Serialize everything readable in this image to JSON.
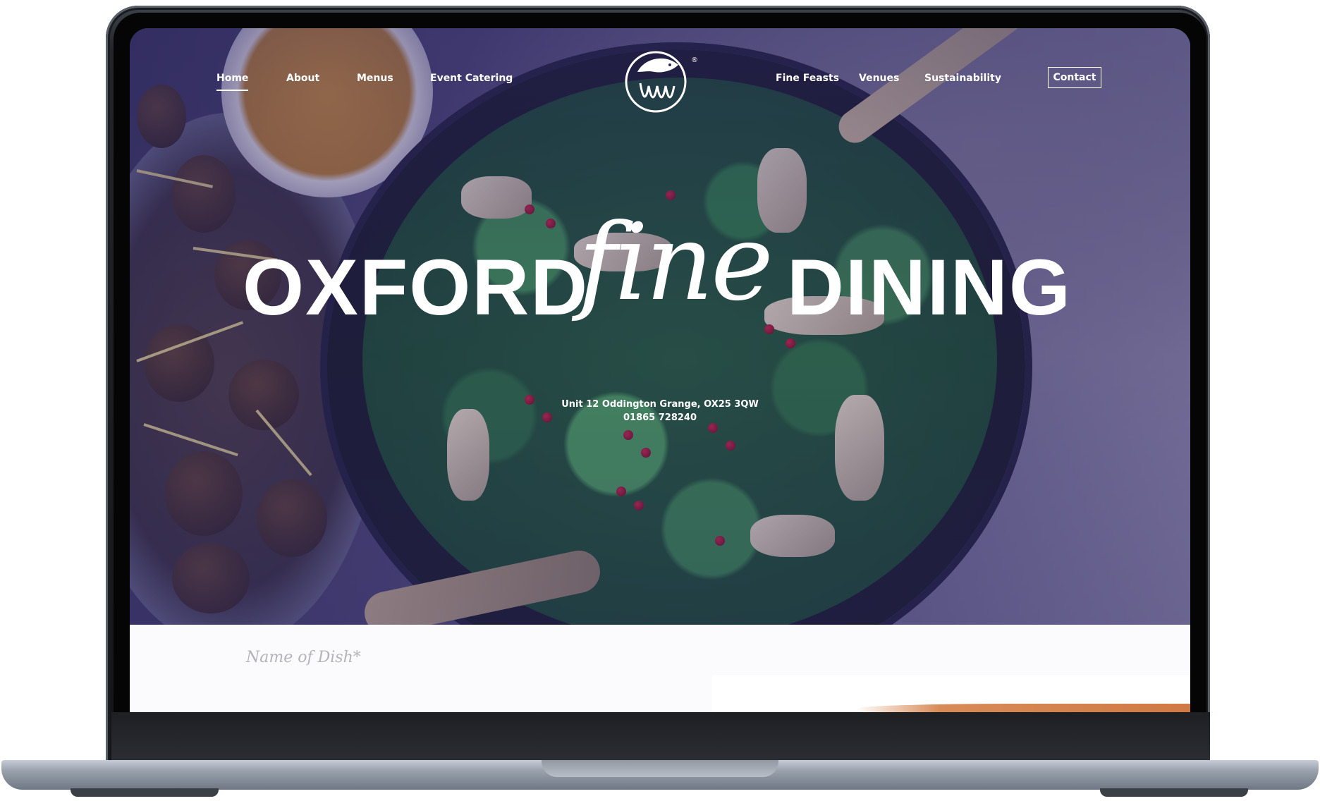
{
  "nav": {
    "home": "Home",
    "about": "About",
    "menus": "Menus",
    "event_catering": "Event Catering",
    "fine_feasts": "Fine Feasts",
    "venues": "Venues",
    "sustainability": "Sustainability",
    "contact": "Contact"
  },
  "brand": {
    "logo_icon": "bird-logo-icon",
    "registered": "®"
  },
  "hero": {
    "title_left": "OXFORD",
    "title_script": "fine",
    "title_right": "DINING",
    "address": "Unit 12 Oddington Grange, OX25 3QW",
    "phone": "01865 728240"
  },
  "form": {
    "dish_label": "Name of Dish*"
  },
  "colors": {
    "tint": "#282464",
    "text": "#ffffff",
    "frame": "#141518",
    "lower_bg": "#fbfbfd"
  }
}
